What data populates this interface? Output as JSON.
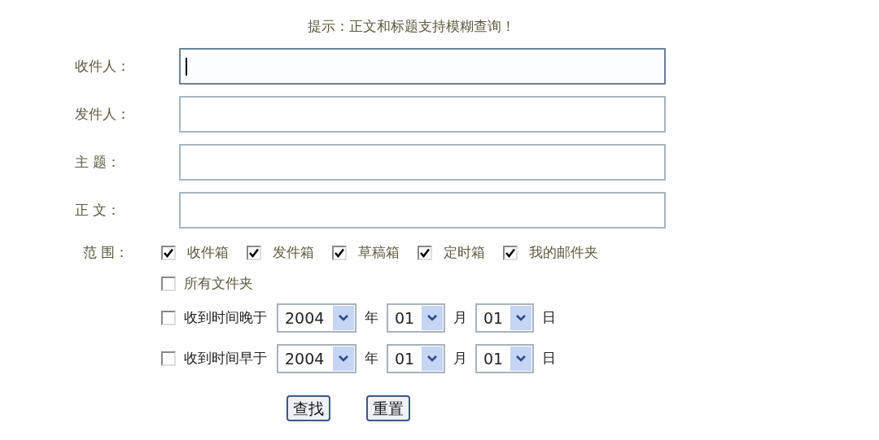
{
  "hint": "提示：正文和标题支持模糊查询！",
  "fields": [
    {
      "label": "收件人：",
      "focused": true
    },
    {
      "label": "发件人：",
      "focused": false
    },
    {
      "label": "主 题：",
      "focused": false
    },
    {
      "label": "正 文：",
      "focused": false
    }
  ],
  "scope": {
    "label": "范 围：",
    "folders": [
      {
        "label": "收件箱",
        "checked": true
      },
      {
        "label": "发件箱",
        "checked": true
      },
      {
        "label": "草稿箱",
        "checked": true
      },
      {
        "label": "定时箱",
        "checked": true
      },
      {
        "label": "我的邮件夹",
        "checked": true
      }
    ],
    "all_folders": {
      "label": "所有文件夹",
      "checked": false
    }
  },
  "date_filters": [
    {
      "label": "收到时间晚于",
      "checked": false,
      "year": "2004",
      "year_unit": "年",
      "month": "01",
      "month_unit": "月",
      "day": "01",
      "day_unit": "日"
    },
    {
      "label": "收到时间早于",
      "checked": false,
      "year": "2004",
      "year_unit": "年",
      "month": "01",
      "month_unit": "月",
      "day": "01",
      "day_unit": "日"
    }
  ],
  "buttons": [
    "查找",
    "重置"
  ]
}
